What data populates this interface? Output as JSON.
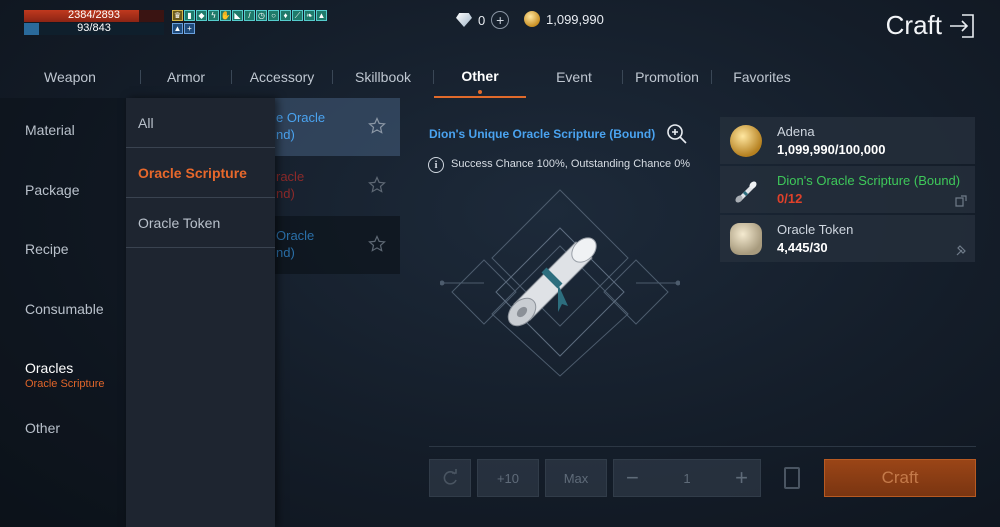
{
  "hud": {
    "hp_text": "2384/2893",
    "hp_fraction": 0.824,
    "mp_text": "93/843",
    "mp_fraction": 0.11,
    "diamonds": "0",
    "adena": "1,099,990"
  },
  "header": {
    "title": "Craft"
  },
  "tabs": [
    {
      "label": "Weapon"
    },
    {
      "label": "Armor"
    },
    {
      "label": "Accessory"
    },
    {
      "label": "Skillbook"
    },
    {
      "label": "Other",
      "active": true
    },
    {
      "label": "Event"
    },
    {
      "label": "Promotion"
    },
    {
      "label": "Favorites"
    }
  ],
  "categories": {
    "material": "Material",
    "package": "Package",
    "recipe": "Recipe",
    "consumable": "Consumable",
    "oracles": "Oracles",
    "oracles_sub": "Oracle Scripture",
    "other": "Other"
  },
  "recipes": [
    {
      "line1": "e Oracle",
      "line2": "nd)"
    },
    {
      "line1": "racle",
      "line2": "nd)"
    },
    {
      "line1": "Oracle",
      "line2": "nd)"
    }
  ],
  "dropdown": {
    "all": "All",
    "scripture": "Oracle Scripture",
    "token": "Oracle Token"
  },
  "detail": {
    "title": "Dion's Unique Oracle Scripture (Bound)",
    "chance": "Success Chance 100%, Outstanding Chance 0%"
  },
  "materials": [
    {
      "name": "Adena",
      "count": "1,099,990/100,000"
    },
    {
      "name": "Dion's Oracle Scripture (Bound)",
      "count": "0/12"
    },
    {
      "name": "Oracle Token",
      "count": "4,445/30"
    }
  ],
  "controls": {
    "plus10": "+10",
    "max": "Max",
    "minus": "−",
    "quantity": "1",
    "plus": "+",
    "craft": "Craft"
  },
  "colors": {
    "accent": "#e06a2b",
    "title_blue": "#4aa3f0",
    "insufficient_red": "#e0412a",
    "material_green": "#3ec85a"
  }
}
